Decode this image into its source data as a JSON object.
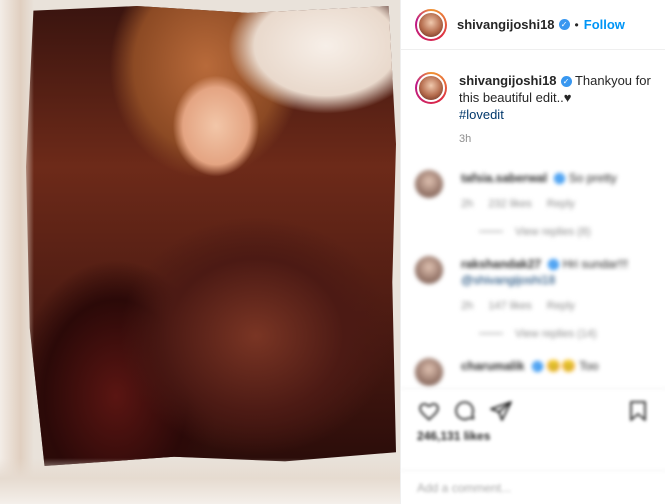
{
  "post": {
    "author": "shivangijoshi18",
    "follow_label": "Follow",
    "dot": "•"
  },
  "caption": {
    "username": "shivangijoshi18",
    "text": "Thankyou for this beautiful edit..♥",
    "hashtag": "#lovedit",
    "time": "3h"
  },
  "comments": [
    {
      "user": "tafsia.saberwal",
      "text": "So pretty",
      "age": "2h",
      "likes": "232 likes",
      "reply": "Reply",
      "replies": "View replies (8)"
    },
    {
      "user": "rakshandak27",
      "text": "Hri sundar!!!",
      "mention": "@shivangijoshi18",
      "age": "2h",
      "likes": "147 likes",
      "reply": "Reply",
      "replies": "View replies (14)"
    },
    {
      "user": "charumalik",
      "text": "Too",
      "emoji": "😊😊"
    }
  ],
  "actions": {
    "likes_count": "246,131 likes"
  },
  "add_comment": {
    "placeholder": "Add a comment..."
  },
  "icons": {
    "like": "heart-icon",
    "comment": "comment-icon",
    "share": "send-icon",
    "save": "bookmark-icon",
    "verified": "verified-badge-icon"
  },
  "colors": {
    "follow": "#0095f6",
    "verified": "#3897f0",
    "hashtag": "#00376b",
    "meta_grey": "#8e8e8e"
  }
}
